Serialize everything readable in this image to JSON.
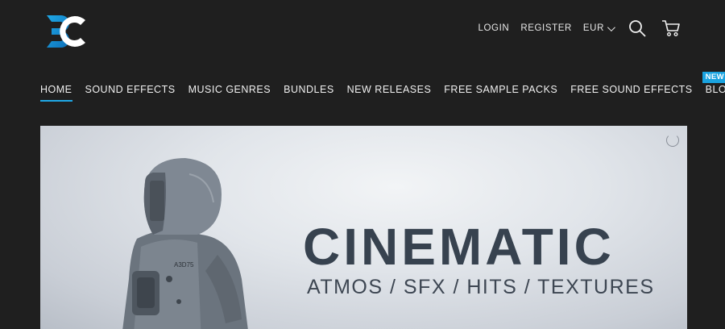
{
  "brand": {
    "logo_text": "BC",
    "accent": "#1fa8e6"
  },
  "utility": {
    "login": "LOGIN",
    "register": "REGISTER",
    "currency": "EUR"
  },
  "nav": {
    "items": [
      {
        "label": "HOME",
        "active": true
      },
      {
        "label": "SOUND EFFECTS"
      },
      {
        "label": "MUSIC GENRES"
      },
      {
        "label": "BUNDLES"
      },
      {
        "label": "NEW RELEASES"
      },
      {
        "label": "FREE SAMPLE PACKS"
      },
      {
        "label": "FREE SOUND EFFECTS"
      },
      {
        "label": "BLOG",
        "badge": "NEW"
      }
    ]
  },
  "hero": {
    "title": "CINEMATIC",
    "subtitle": "ATMOS / SFX / HITS / TEXTURES",
    "suit_label": "A3D75"
  }
}
